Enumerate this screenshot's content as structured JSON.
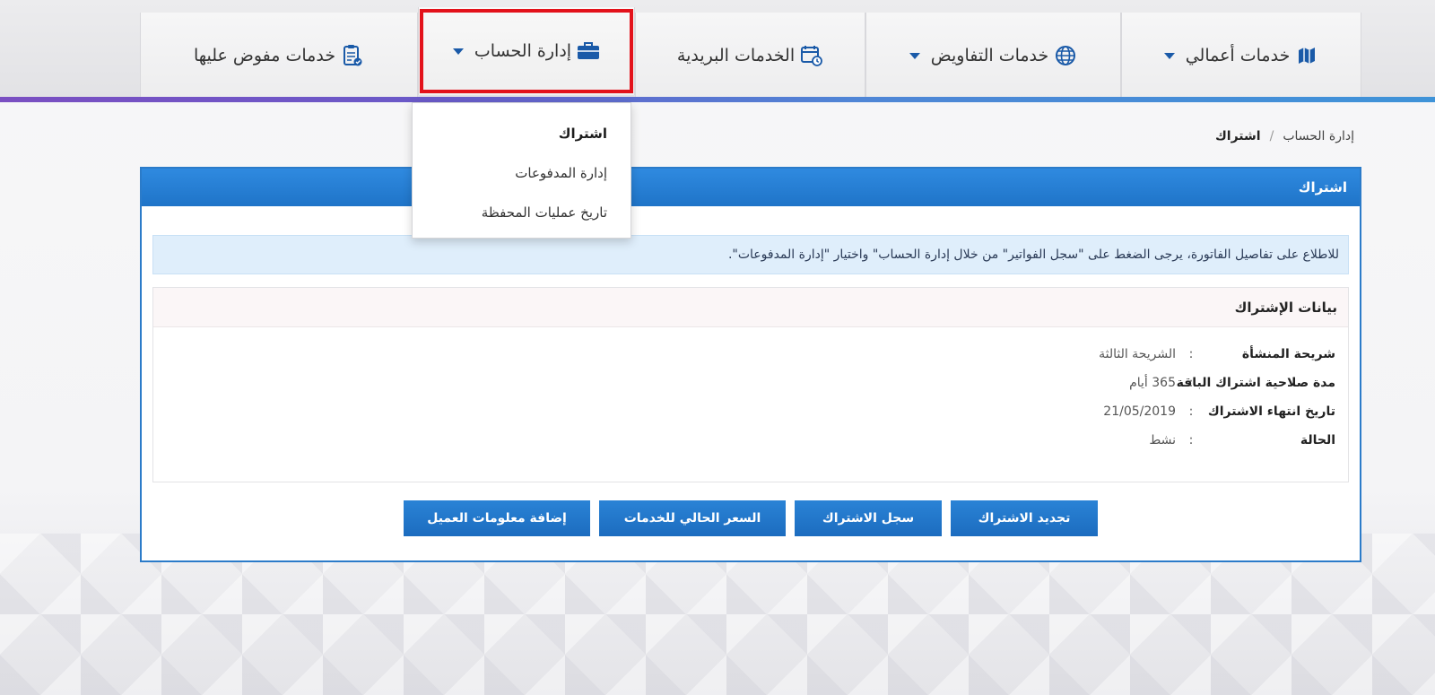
{
  "nav": {
    "tabs": [
      {
        "label": "خدمات أعمالي",
        "icon": "business-map-icon",
        "has_dropdown": true
      },
      {
        "label": "خدمات التفاويض",
        "icon": "globe-icon",
        "has_dropdown": true
      },
      {
        "label": "الخدمات البريدية",
        "icon": "calendar-clock-icon",
        "has_dropdown": false
      },
      {
        "label": "إدارة الحساب",
        "icon": "briefcase-icon",
        "has_dropdown": true,
        "active": true
      },
      {
        "label": "خدمات مفوض عليها",
        "icon": "clipboard-check-icon",
        "has_dropdown": false
      }
    ]
  },
  "dropdown": {
    "items": [
      "اشتراك",
      "إدارة المدفوعات",
      "تاريخ عمليات المحفظة"
    ]
  },
  "breadcrumb": {
    "parent": "إدارة الحساب",
    "separator": "/",
    "current": "اشتراك"
  },
  "panel": {
    "title": "اشتراك",
    "notice": "للاطلاع على تفاصيل الفاتورة، يرجى الضغط على \"سجل الفواتير\" من خلال إدارة الحساب\" واختيار \"إدارة المدفوعات\".",
    "info_title": "بيانات الإشتراك",
    "rows": [
      {
        "label": "شريحة المنشأة",
        "value": "الشريحة الثالثة"
      },
      {
        "label": "مدة صلاحية اشتراك الباقة",
        "value": "365 أيام"
      },
      {
        "label": "تاريخ انتهاء الاشتراك",
        "value": "21/05/2019"
      },
      {
        "label": "الحالة",
        "value": "نشط"
      }
    ],
    "colon": ":",
    "buttons": {
      "renew": "تجديد الاشتراك",
      "history": "سجل الاشتراك",
      "price": "السعر الحالي للخدمات",
      "client_info": "إضافة معلومات العميل"
    }
  },
  "colors": {
    "accent": "#1f74c8",
    "highlight_border": "#e3121b",
    "notice_bg": "#dfeefb"
  }
}
